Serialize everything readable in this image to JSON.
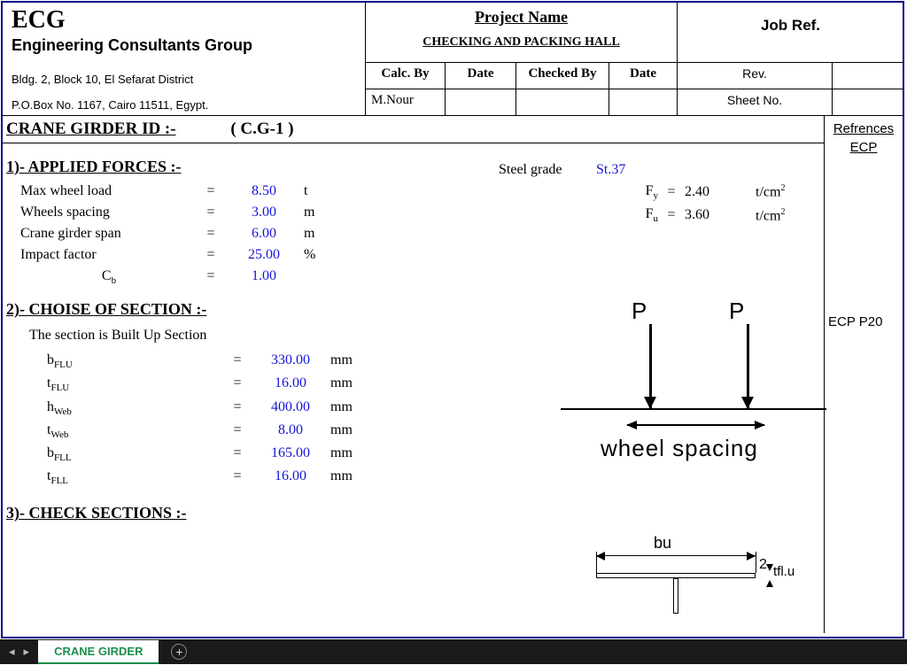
{
  "header": {
    "company_short": "ECG",
    "company_long": "Engineering Consultants Group",
    "address1": "Bldg. 2, Block 10, El Sefarat District",
    "address2": "P.O.Box No. 1167, Cairo 11511, Egypt.",
    "project_name_label": "Project Name",
    "project_name_value": "CHECKING AND PACKING HALL",
    "job_ref_label": "Job Ref.",
    "cols": {
      "calc_by": "Calc. By",
      "date1": "Date",
      "checked_by": "Checked By",
      "date2": "Date"
    },
    "calc_by_value": "M.Nour",
    "rev_label": "Rev.",
    "sheet_no_label": "Sheet No."
  },
  "title": {
    "label": "CRANE GIRDER ID :-",
    "value": "( C.G-1 )"
  },
  "sections": {
    "s1": "1)- APPLIED FORCES :-",
    "s2": "2)- CHOISE OF SECTION :-",
    "s2_note": "The section is Built Up Section",
    "s3": "3)- CHECK SECTIONS :-"
  },
  "applied_forces": [
    {
      "label": "Max wheel load",
      "value": "8.50",
      "unit": "t"
    },
    {
      "label": "Wheels spacing",
      "value": "3.00",
      "unit": "m"
    },
    {
      "label": "Crane girder span",
      "value": "6.00",
      "unit": "m"
    },
    {
      "label": "Impact factor",
      "value": "25.00",
      "unit": "%"
    },
    {
      "label_html": "C_b",
      "value": "1.00",
      "unit": ""
    }
  ],
  "steel": {
    "grade_label": "Steel grade",
    "grade_value": "St.37",
    "fy_label": "F_y",
    "fy_value": "2.40",
    "fy_unit": "t/cm²",
    "fu_label": "F_u",
    "fu_value": "3.60",
    "fu_unit": "t/cm²"
  },
  "section_props": [
    {
      "label": "b_FLU",
      "value": "330.00",
      "unit": "mm"
    },
    {
      "label": "t_FLU",
      "value": "16.00",
      "unit": "mm"
    },
    {
      "label": "h_Web",
      "value": "400.00",
      "unit": "mm"
    },
    {
      "label": "t_Web",
      "value": "8.00",
      "unit": "mm"
    },
    {
      "label": "b_FLL",
      "value": "165.00",
      "unit": "mm"
    },
    {
      "label": "t_FLL",
      "value": "16.00",
      "unit": "mm"
    }
  ],
  "diagram": {
    "P": "P",
    "wheel_spacing": "wheel spacing",
    "bu": "bu",
    "tflu": "tfl.u",
    "two": "2"
  },
  "references": {
    "header": "Refrences",
    "ecp": "ECP",
    "ecp_p20": "ECP P20"
  },
  "tabbar": {
    "active_tab": "CRANE GIRDER",
    "nav_left": "◂",
    "nav_right": "▸",
    "add": "+"
  }
}
